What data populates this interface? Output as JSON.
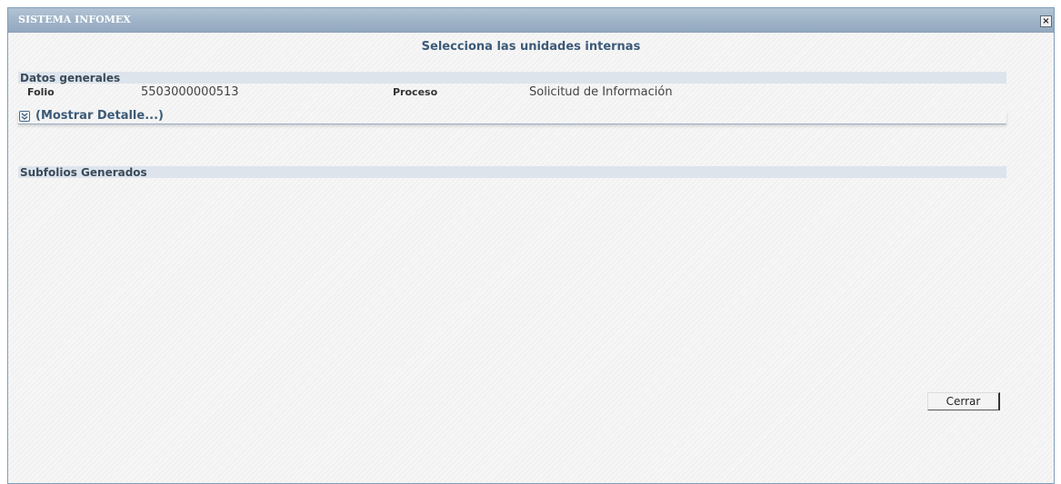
{
  "window": {
    "title": "SISTEMA INFOMEX",
    "close_glyph": "×"
  },
  "dialog": {
    "subtitle": "Selecciona las unidades internas"
  },
  "datos_generales": {
    "header": "Datos generales",
    "folio_label": "Folio",
    "folio_value": "5503000000513",
    "proceso_label": "Proceso",
    "proceso_value": "Solicitud de Información",
    "detail_link": "(Mostrar Detalle...)"
  },
  "subfolios": {
    "header": "Subfolios Generados"
  },
  "actions": {
    "cerrar_label": "Cerrar"
  },
  "colors": {
    "title_bar": "#9fb3c8",
    "section_header": "#dde4ec",
    "accent_text": "#3c5a78"
  },
  "icons": {
    "close": "close-icon",
    "expand": "double-chevron-down-icon"
  }
}
